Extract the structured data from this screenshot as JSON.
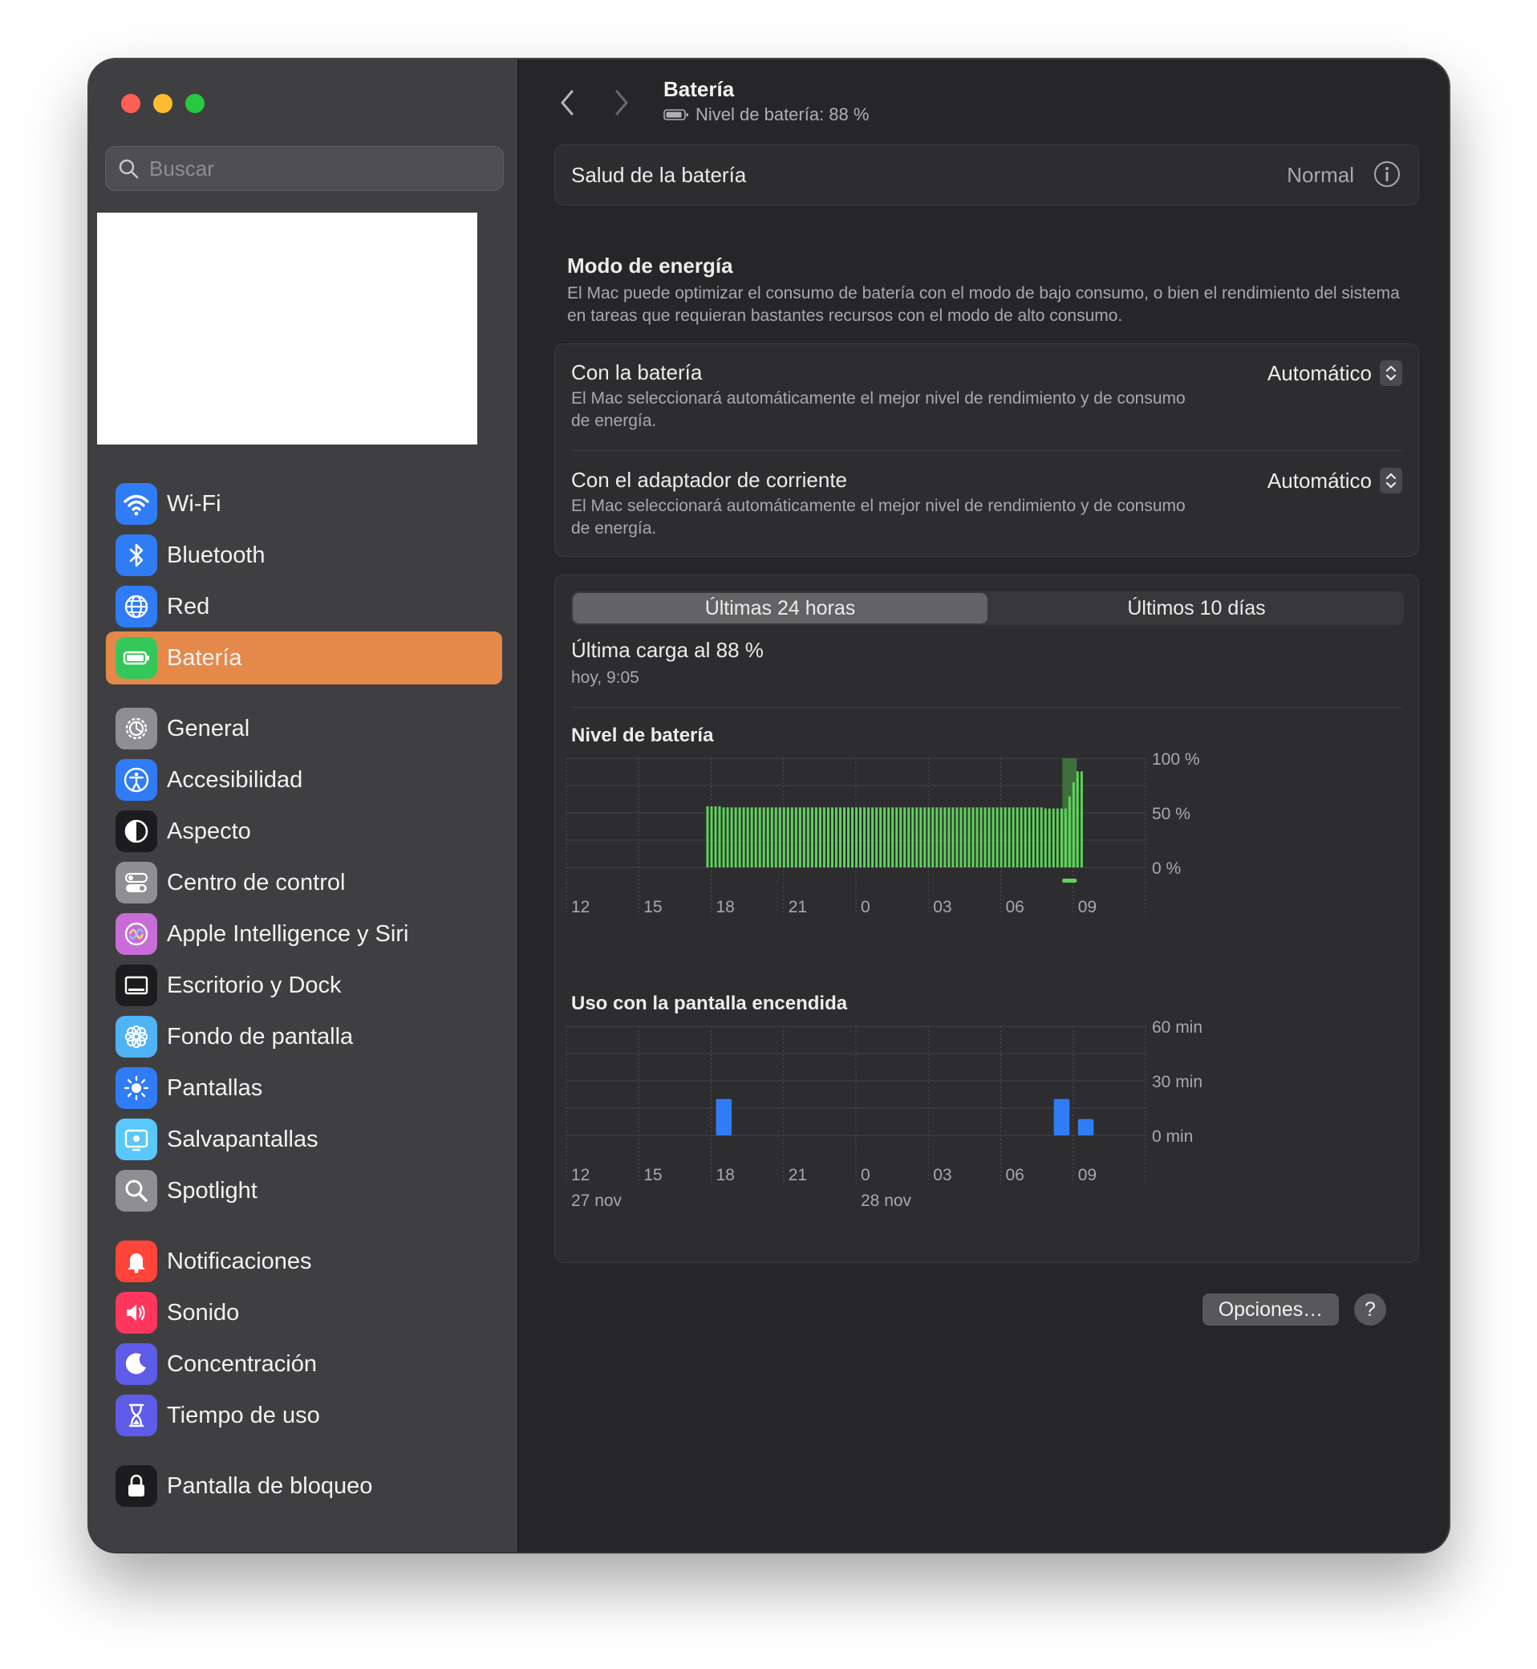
{
  "sidebar": {
    "search_placeholder": "Buscar",
    "items": [
      {
        "id": "wifi",
        "label": "Wi-Fi",
        "icon": "wifi-icon",
        "color": "#2f7cf6"
      },
      {
        "id": "bluetooth",
        "label": "Bluetooth",
        "icon": "bluetooth-icon",
        "color": "#2f7cf6"
      },
      {
        "id": "red",
        "label": "Red",
        "icon": "globe-icon",
        "color": "#2f7cf6"
      },
      {
        "id": "bateria",
        "label": "Batería",
        "icon": "battery-icon",
        "color": "#34c759",
        "active": true
      },
      {
        "id": "general",
        "label": "General",
        "icon": "gear-icon",
        "color": "#8e8e93"
      },
      {
        "id": "accesibilidad",
        "label": "Accesibilidad",
        "icon": "accessibility-icon",
        "color": "#2f7cf6"
      },
      {
        "id": "aspecto",
        "label": "Aspecto",
        "icon": "appearance-icon",
        "color": "#1c1c1e"
      },
      {
        "id": "centro-control",
        "label": "Centro de control",
        "icon": "toggles-icon",
        "color": "#8e8e93"
      },
      {
        "id": "apple-intelligence",
        "label": "Apple Intelligence y Siri",
        "icon": "siri-icon",
        "color": "#c86dd7"
      },
      {
        "id": "escritorio-dock",
        "label": "Escritorio y Dock",
        "icon": "dock-icon",
        "color": "#1c1c1e"
      },
      {
        "id": "fondo",
        "label": "Fondo de pantalla",
        "icon": "flower-icon",
        "color": "#4fb3f5"
      },
      {
        "id": "pantallas",
        "label": "Pantallas",
        "icon": "sun-icon",
        "color": "#2f7cf6"
      },
      {
        "id": "salvapantallas",
        "label": "Salvapantallas",
        "icon": "screensaver-icon",
        "color": "#5ac8fa"
      },
      {
        "id": "spotlight",
        "label": "Spotlight",
        "icon": "magnifier-icon",
        "color": "#8e8e93"
      },
      {
        "id": "notificaciones",
        "label": "Notificaciones",
        "icon": "bell-icon",
        "color": "#ff453a"
      },
      {
        "id": "sonido",
        "label": "Sonido",
        "icon": "speaker-icon",
        "color": "#ff375f"
      },
      {
        "id": "concentracion",
        "label": "Concentración",
        "icon": "moon-icon",
        "color": "#5e5ce6"
      },
      {
        "id": "tiempo-uso",
        "label": "Tiempo de uso",
        "icon": "hourglass-icon",
        "color": "#5e5ce6"
      },
      {
        "id": "pantalla-bloqueo",
        "label": "Pantalla de bloqueo",
        "icon": "lock-icon",
        "color": "#1c1c1e"
      }
    ]
  },
  "toolbar": {
    "title": "Batería",
    "subtitle": "Nivel de batería: 88 %"
  },
  "health": {
    "label": "Salud de la batería",
    "value": "Normal"
  },
  "energy_mode": {
    "title": "Modo de energía",
    "description": "El Mac puede optimizar el consumo de batería con el modo de bajo consumo, o bien el rendimiento del sistema en tareas que requieran bastantes recursos con el modo de alto consumo.",
    "rows": [
      {
        "title": "Con la batería",
        "description": "El Mac seleccionará automáticamente el mejor nivel de rendimiento y de consumo de energía.",
        "value": "Automático"
      },
      {
        "title": "Con el adaptador de corriente",
        "description": "El Mac seleccionará automáticamente el mejor nivel de rendimiento y de consumo de energía.",
        "value": "Automático"
      }
    ]
  },
  "usage": {
    "tabs": [
      "Últimas 24 horas",
      "Últimos 10 días"
    ],
    "selected_tab": 0,
    "last_charge": "Última carga al 88 %",
    "last_charge_time": "hoy, 9:05"
  },
  "chart_data": [
    {
      "type": "bar",
      "title": "Nivel de batería",
      "x_ticks": [
        "12",
        "15",
        "18",
        "21",
        "0",
        "03",
        "06",
        "09"
      ],
      "y_ticks": [
        "100 %",
        "50 %",
        "0 %"
      ],
      "ylim": [
        0,
        100
      ],
      "x_range_hours": [
        12,
        36
      ],
      "series": [
        {
          "values": [
            56,
            56,
            56,
            56,
            55,
            55,
            55,
            55,
            55,
            55,
            55,
            55,
            55,
            55,
            55,
            55,
            55,
            55,
            55,
            55,
            55,
            55,
            55,
            55,
            55,
            55,
            55,
            55,
            55,
            55,
            55,
            55,
            55,
            55,
            55,
            55,
            55,
            55,
            55,
            55,
            55,
            55,
            55,
            55,
            55,
            55,
            55,
            55,
            55,
            55,
            55,
            55,
            55,
            55,
            55,
            55,
            55,
            55,
            55,
            55,
            55,
            55,
            55,
            55,
            55,
            55,
            55,
            55,
            55,
            55,
            55,
            55,
            55,
            55,
            55,
            55,
            55,
            55,
            55,
            55,
            55,
            55,
            55,
            55,
            54,
            54,
            54,
            54,
            54,
            54,
            65,
            78,
            88,
            88
          ],
          "start_hour": 17.8,
          "step_hours": 0.1667
        }
      ],
      "charging_window_hours": [
        32.55,
        33.15
      ],
      "colors": {
        "bar": "#5ed35a",
        "charging": "#3e6f3d"
      }
    },
    {
      "type": "bar",
      "title": "Uso con la pantalla encendida",
      "x_ticks": [
        "12",
        "15",
        "18",
        "21",
        "0",
        "03",
        "06",
        "09"
      ],
      "x_sub_labels": [
        {
          "at": "12",
          "label": "27 nov"
        },
        {
          "at": "0",
          "label": "28 nov"
        }
      ],
      "y_ticks": [
        "60 min",
        "30 min",
        "0 min"
      ],
      "ylim": [
        0,
        60
      ],
      "x": [
        18,
        32,
        33
      ],
      "values": [
        20,
        20,
        9
      ],
      "colors": {
        "bar": "#2f7cf6"
      }
    }
  ],
  "footer": {
    "options_label": "Opciones…",
    "help_label": "?"
  }
}
